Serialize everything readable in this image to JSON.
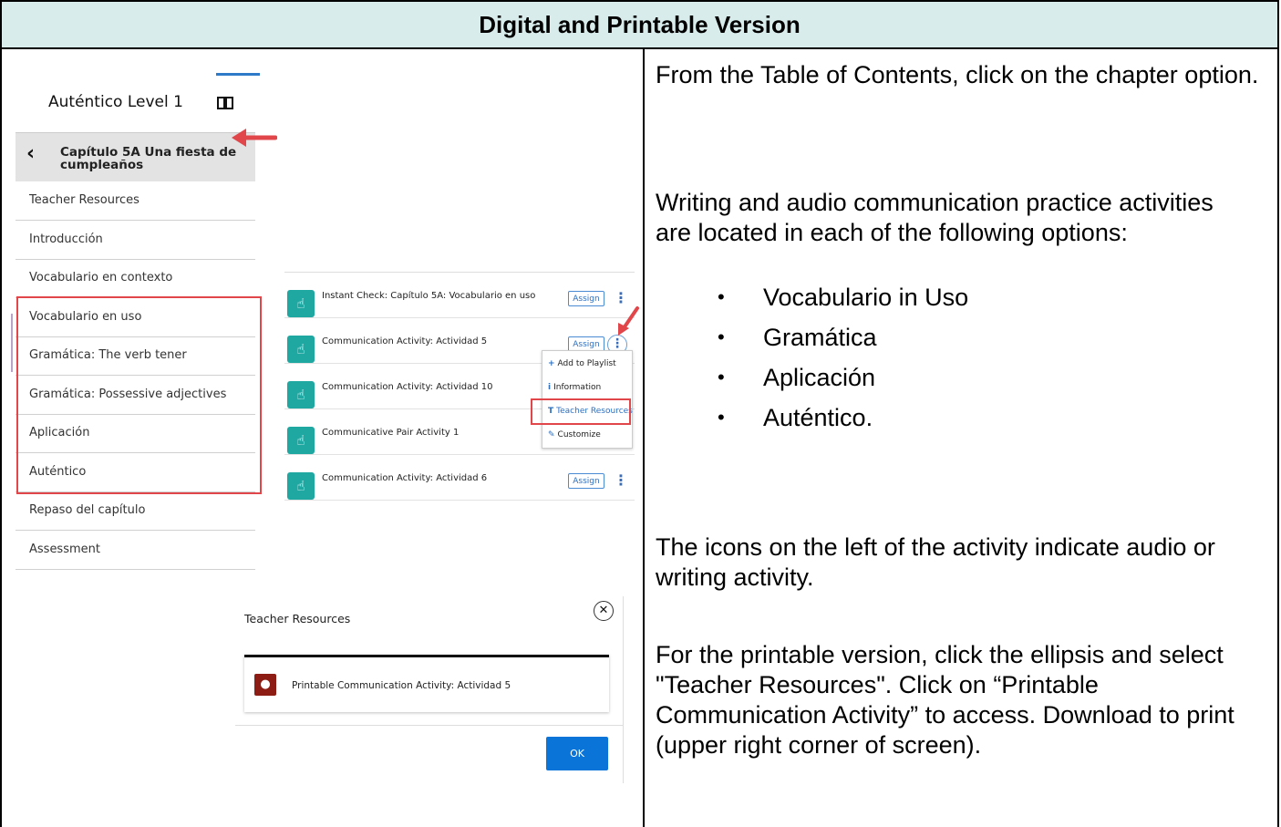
{
  "header": {
    "title": "Digital and Printable Version"
  },
  "sidebar": {
    "title": "Auténtico Level 1",
    "chapter": "Capítulo 5A Una fiesta de cumpleaños",
    "items": [
      "Teacher Resources",
      "Introducción",
      "Vocabulario en contexto",
      "Vocabulario en uso",
      "Gramática: The verb tener",
      "Gramática: Possessive adjectives",
      "Aplicación",
      "Auténtico",
      "Repaso del capítulo",
      "Assessment"
    ]
  },
  "activities": {
    "rows": [
      {
        "title": "Instant Check: Capítulo 5A: Vocabulario en uso",
        "assign": "Assign"
      },
      {
        "title": "Communication Activity: Actividad 5",
        "assign": "Assign"
      },
      {
        "title": "Communication Activity: Actividad 10",
        "assign": ""
      },
      {
        "title": "Communicative Pair Activity 1",
        "assign": ""
      },
      {
        "title": "Communication Activity: Actividad 6",
        "assign": "Assign"
      }
    ],
    "menu": [
      "Add to Playlist",
      "Information",
      "Teacher Resources",
      "Customize"
    ]
  },
  "dialog": {
    "title": "Teacher Resources",
    "item": "Printable Communication Activity: Actividad 5",
    "ok": "OK"
  },
  "instructions": {
    "p1": "From the Table of Contents, click on the chapter option.",
    "p2": "Writing and audio communication practice activities are located in each of the following options:",
    "bullets": [
      "Vocabulario in Uso",
      "Gramática",
      "Aplicación",
      "Auténtico."
    ],
    "p3": "The icons on the left of the activity indicate audio or writing activity.",
    "p4": "For the printable version, click the ellipsis and select \"Teacher Resources\". Click on “Printable Communication Activity” to access. Download to print (upper right corner of screen)."
  },
  "colors": {
    "header_bg": "#d9ecec",
    "teal_icon": "#1fa7a2",
    "highlight_red": "#e0464a",
    "ok_blue": "#0a74d8"
  }
}
